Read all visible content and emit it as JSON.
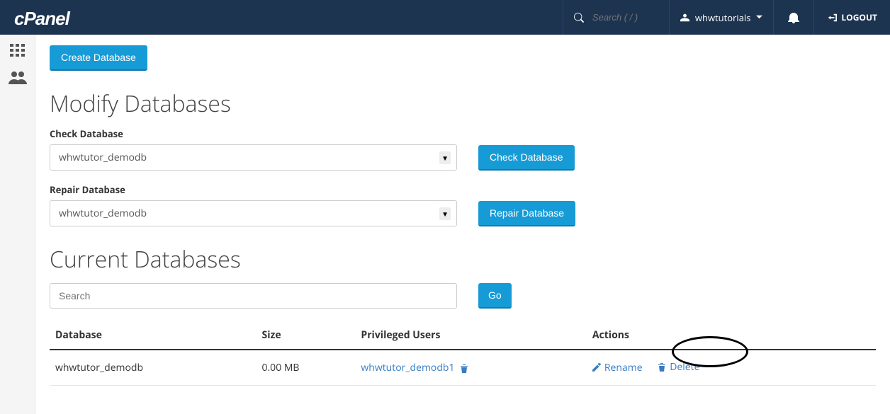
{
  "header": {
    "logo": "cPanel",
    "search_placeholder": "Search ( / )",
    "username": "whwtutorials",
    "logout": "LOGOUT"
  },
  "page": {
    "create_db_button": "Create Database",
    "modify_heading": "Modify Databases",
    "check_db_label": "Check Database",
    "check_db_selected": "whwtutor_demodb",
    "check_db_button": "Check Database",
    "repair_db_label": "Repair Database",
    "repair_db_selected": "whwtutor_demodb",
    "repair_db_button": "Repair Database",
    "current_heading": "Current Databases",
    "search_placeholder": "Search",
    "go_button": "Go"
  },
  "table": {
    "columns": {
      "database": "Database",
      "size": "Size",
      "users": "Privileged Users",
      "actions": "Actions"
    },
    "rows": [
      {
        "database": "whwtutor_demodb",
        "size": "0.00 MB",
        "user": "whwtutor_demodb1",
        "rename": "Rename",
        "delete": "Delete"
      }
    ]
  }
}
